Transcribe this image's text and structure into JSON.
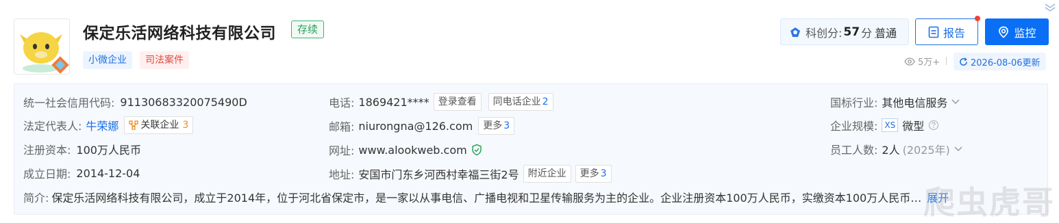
{
  "company": {
    "name": "保定乐活网络科技有限公司",
    "status": "存续",
    "tags": [
      "小微企业",
      "司法案件"
    ]
  },
  "header_actions": {
    "score_label": "科创分:",
    "score_value": "57",
    "score_unit": "分",
    "score_level": "普通",
    "report_label": "报告",
    "monitor_label": "监控",
    "views": "5万+",
    "update_text": "2026-08-06更新"
  },
  "details": {
    "credit_code_label": "统一社会信用代码:",
    "credit_code": "91130683320075490D",
    "legal_rep_label": "法定代表人:",
    "legal_rep": "牛荣娜",
    "related_label": "关联企业",
    "related_count": "3",
    "capital_label": "注册资本:",
    "capital": "100万人民币",
    "founded_label": "成立日期:",
    "founded": "2014-12-04",
    "phone_label": "电话:",
    "phone": "1869421****",
    "phone_btn": "登录查看",
    "same_phone_label": "同电话企业",
    "same_phone_count": "2",
    "email_label": "邮箱:",
    "email": "niurongna@126.com",
    "email_more_label": "更多",
    "email_more_count": "3",
    "website_label": "网址:",
    "website": "www.alookweb.com",
    "address_label": "地址:",
    "address": "安国市门东乡河西村幸福三街2号",
    "nearby_label": "附近企业",
    "address_more_label": "更多",
    "address_more_count": "3",
    "industry_label": "国标行业:",
    "industry": "其他电信服务",
    "scale_label": "企业规模:",
    "scale_badge": "XS",
    "scale": "微型",
    "staff_label": "员工人数:",
    "staff": "2人",
    "staff_year": "(2025年)",
    "intro_label": "简介:",
    "intro": "保定乐活网络科技有限公司，成立于2014年，位于河北省保定市，是一家以从事电信、广播电视和卫星传输服务为主的企业。企业注册资本100万人民币，实缴资本100万人民币…",
    "expand_label": "展开"
  },
  "watermark": "爬虫虎哥",
  "colors": {
    "brand_blue": "#0a6ff5",
    "status_green": "#2e9e5f",
    "tag_red": "#e0483b",
    "related_orange": "#f08c1a"
  },
  "icons": [
    "mascot-logo",
    "diamond-icon",
    "report-icon",
    "monitor-icon",
    "eye-icon",
    "refresh-icon",
    "verified-shield-icon",
    "chevron-down-icon",
    "help-circle-icon",
    "related-network-icon",
    "corner-expand-icon"
  ]
}
